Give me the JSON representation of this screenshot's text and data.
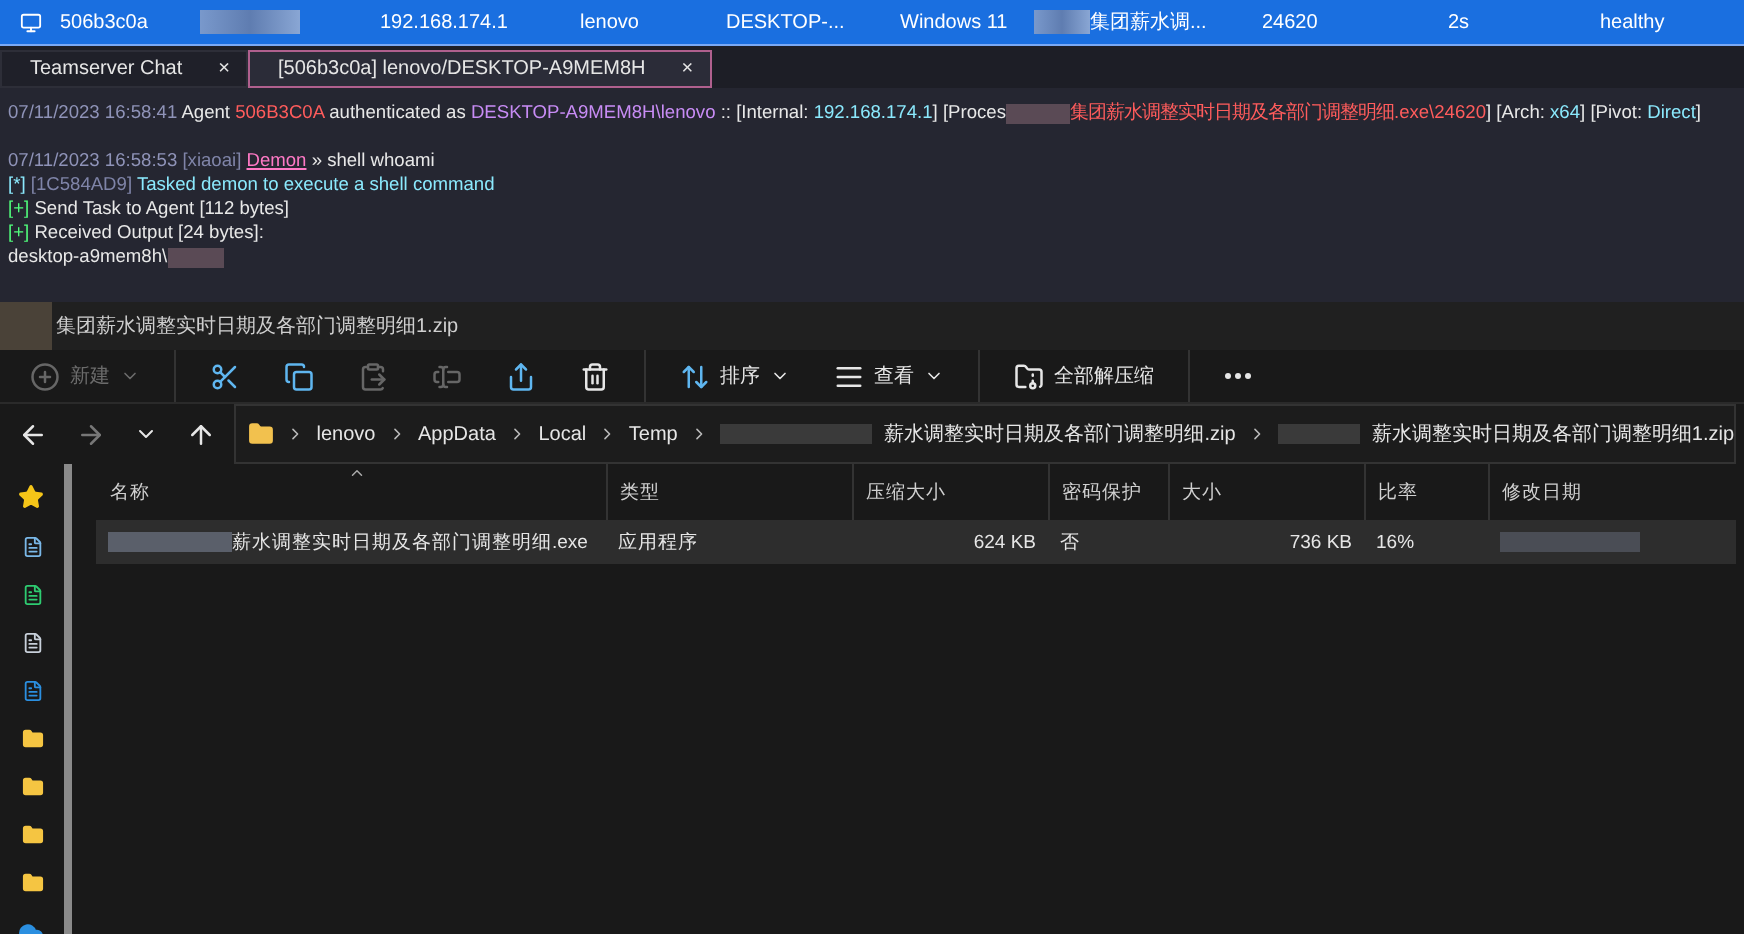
{
  "session_row": {
    "selected": true,
    "cells": [
      {
        "kind": "text",
        "text": "506b3c0a"
      },
      {
        "kind": "redacted"
      },
      {
        "kind": "text",
        "text": "192.168.174.1"
      },
      {
        "kind": "text",
        "text": "lenovo"
      },
      {
        "kind": "text",
        "text": "DESKTOP-..."
      },
      {
        "kind": "text",
        "text": "Windows 11"
      },
      {
        "kind": "redacted_text",
        "text": "集团薪水调..."
      },
      {
        "kind": "text",
        "text": "24620"
      },
      {
        "kind": "text",
        "text": "2s"
      },
      {
        "kind": "text",
        "text": "healthy"
      }
    ]
  },
  "tabs": [
    {
      "label": "Teamserver Chat",
      "close": "×",
      "selected": false
    },
    {
      "label": "[506b3c0a] lenovo/DESKTOP-A9MEM8H",
      "close": "×",
      "selected": true
    }
  ],
  "console": {
    "blocks": [
      {
        "lines": [
          [
            {
              "kind": "time",
              "text": "07/11/2023 16:58:41"
            },
            {
              "kind": "plain",
              "text": " Agent "
            },
            {
              "kind": "agent",
              "text": "506B3C0A"
            },
            {
              "kind": "plain",
              "text": " authenticated as "
            },
            {
              "kind": "host",
              "text": "DESKTOP-A9MEM8H\\lenovo"
            },
            {
              "kind": "plain",
              "text": " :: [Internal: "
            },
            {
              "kind": "value",
              "text": "192.168.174.1"
            },
            {
              "kind": "plain",
              "text": "] [Proces"
            },
            {
              "kind": "redacted"
            },
            {
              "kind": "agent",
              "text": "集团薪水调整实时日期及各部门调整明细.exe\\24620"
            },
            {
              "kind": "plain",
              "text": "] [Arch: "
            },
            {
              "kind": "value",
              "text": "x64"
            },
            {
              "kind": "plain",
              "text": "] [Pivot: "
            },
            {
              "kind": "value",
              "text": "Direct"
            },
            {
              "kind": "plain",
              "text": "]"
            }
          ]
        ]
      },
      {
        "lines": [
          [
            {
              "kind": "time",
              "text": "07/11/2023 16:58:53"
            },
            {
              "kind": "muted",
              "text": " [xiaoai] "
            },
            {
              "kind": "link",
              "text": "Demon"
            },
            {
              "kind": "plain",
              "text": " » shell whoami"
            }
          ],
          [
            {
              "kind": "info",
              "text": "[*]"
            },
            {
              "kind": "muted",
              "text": " [1C584AD9] "
            },
            {
              "kind": "value",
              "text": "Tasked demon to execute a shell command"
            }
          ],
          [
            {
              "kind": "ok",
              "text": "[+]"
            },
            {
              "kind": "plain",
              "text": " Send Task to Agent [112 bytes]"
            }
          ],
          [
            {
              "kind": "ok",
              "text": "[+]"
            },
            {
              "kind": "plain",
              "text": " Received Output [24 bytes]:"
            }
          ],
          [
            {
              "kind": "plain",
              "text": "desktop-a9mem8h\\"
            },
            {
              "kind": "redacted"
            }
          ]
        ]
      }
    ]
  },
  "explorer": {
    "title": "集团薪水调整实时日期及各部门调整明细1.zip",
    "toolbar": [
      {
        "kind": "new",
        "label": "新建",
        "disabled": true
      },
      {
        "kind": "sep"
      },
      {
        "kind": "cut",
        "disabled": false
      },
      {
        "kind": "copy",
        "disabled": false
      },
      {
        "kind": "paste",
        "disabled": true
      },
      {
        "kind": "rename",
        "disabled": true
      },
      {
        "kind": "share",
        "disabled": false
      },
      {
        "kind": "delete",
        "disabled": false
      },
      {
        "kind": "sep"
      },
      {
        "kind": "sort",
        "label": "排序",
        "disabled": false
      },
      {
        "kind": "view",
        "label": "查看",
        "disabled": false
      },
      {
        "kind": "sep"
      },
      {
        "kind": "extract",
        "label": "全部解压缩",
        "disabled": false
      },
      {
        "kind": "sep"
      },
      {
        "kind": "more",
        "disabled": false
      }
    ],
    "nav": [
      {
        "kind": "back",
        "disabled": false
      },
      {
        "kind": "forward",
        "disabled": true
      },
      {
        "kind": "recent",
        "disabled": false
      },
      {
        "kind": "up",
        "disabled": false
      }
    ],
    "breadcrumb": [
      {
        "label": "lenovo",
        "redacted_prefix": false
      },
      {
        "label": "AppData",
        "redacted_prefix": false
      },
      {
        "label": "Local",
        "redacted_prefix": false
      },
      {
        "label": "Temp",
        "redacted_prefix": false
      },
      {
        "label": "薪水调整实时日期及各部门调整明细.zip",
        "redacted_prefix": true
      },
      {
        "label": "薪水调整实时日期及各部门调整明细1.zip",
        "redacted_prefix": true
      }
    ],
    "columns": [
      "名称",
      "类型",
      "压缩大小",
      "密码保护",
      "大小",
      "比率",
      "修改日期"
    ],
    "rows": [
      {
        "selected": true,
        "cells": [
          {
            "kind": "name",
            "text": "薪水调整实时日期及各部门调整明细.exe"
          },
          {
            "kind": "text",
            "text": "应用程序"
          },
          {
            "kind": "num",
            "text": "624 KB"
          },
          {
            "kind": "text",
            "text": "否"
          },
          {
            "kind": "num",
            "text": "736 KB"
          },
          {
            "kind": "text",
            "text": "16%"
          },
          {
            "kind": "redacted"
          }
        ]
      }
    ]
  }
}
